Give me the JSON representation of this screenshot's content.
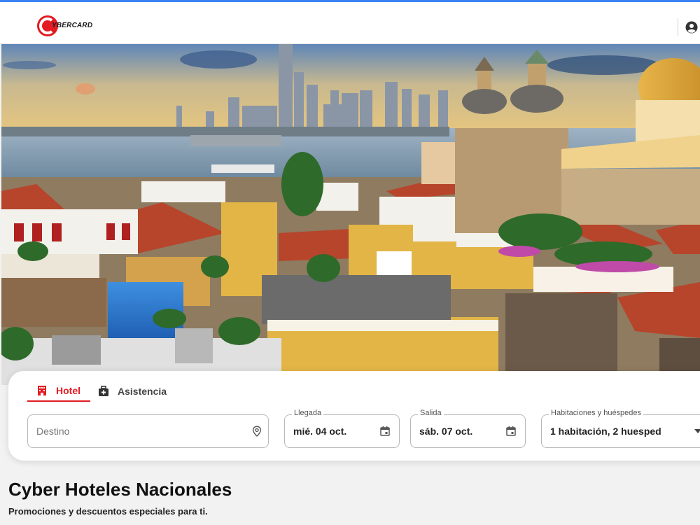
{
  "header": {
    "logo_text": "YBERCARD",
    "brand_color": "#e31b23"
  },
  "hero": {
    "image": "cartagena-skyline-photo"
  },
  "search": {
    "tabs": [
      {
        "label": "Hotel",
        "icon": "hotel-icon",
        "active": true
      },
      {
        "label": "Asistencia",
        "icon": "medical-kit-icon",
        "active": false
      }
    ],
    "destination": {
      "placeholder": "Destino",
      "icon": "location-pin-icon"
    },
    "check_in": {
      "label": "Llegada",
      "value": "mié. 04 oct.",
      "icon": "calendar-icon"
    },
    "check_out": {
      "label": "Salida",
      "value": "sáb. 07 oct.",
      "icon": "calendar-icon"
    },
    "rooms": {
      "label": "Habitaciones y huéspedes",
      "value": "1 habitación, 2 huesped",
      "icon": "chevron-down-icon"
    }
  },
  "section": {
    "title": "Cyber Hoteles Nacionales",
    "subtitle": "Promociones y descuentos especiales para ti."
  }
}
